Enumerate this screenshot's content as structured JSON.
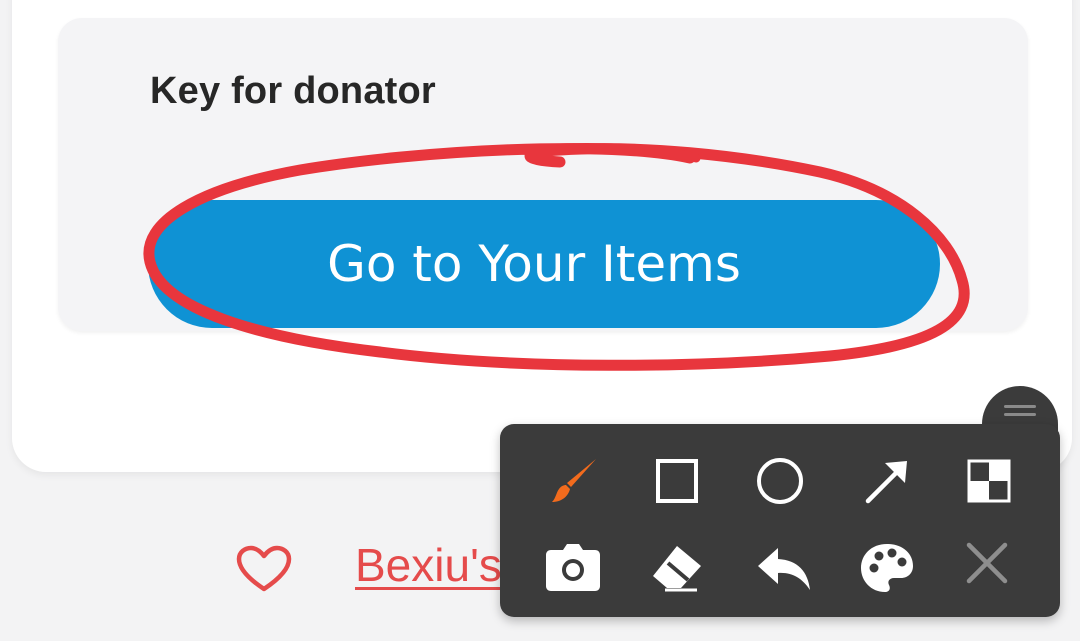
{
  "panel": {
    "label": "Key for donator",
    "button_label": "Go to Your Items"
  },
  "footer": {
    "link_text": "Bexiu's footage"
  },
  "toolbar": {
    "tools": [
      {
        "name": "brush",
        "icon": "brush-icon",
        "active": true
      },
      {
        "name": "rectangle",
        "icon": "square-icon"
      },
      {
        "name": "circle",
        "icon": "circle-icon"
      },
      {
        "name": "arrow",
        "icon": "arrow-icon"
      },
      {
        "name": "mosaic",
        "icon": "mosaic-icon"
      },
      {
        "name": "screenshot",
        "icon": "camera-icon"
      },
      {
        "name": "eraser",
        "icon": "eraser-icon"
      },
      {
        "name": "undo",
        "icon": "undo-icon"
      },
      {
        "name": "color",
        "icon": "palette-icon"
      },
      {
        "name": "close",
        "icon": "close-icon"
      }
    ]
  },
  "colors": {
    "button_blue": "#0f92d4",
    "scribble_red": "#e8363d",
    "brush_orange": "#f26b1d",
    "link_red": "#e54b4b",
    "toolbar_bg": "#3b3b3b"
  }
}
